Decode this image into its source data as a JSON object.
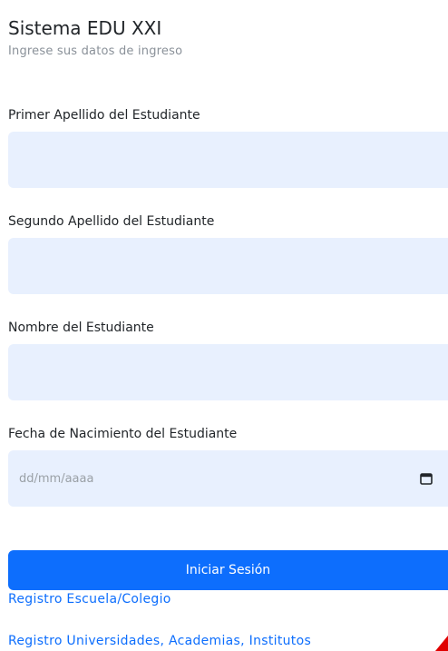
{
  "header": {
    "title": "Sistema EDU XXI",
    "subtitle": "Ingrese sus datos de ingreso"
  },
  "form": {
    "first_surname_label": "Primer Apellido del Estudiante",
    "first_surname_value": "",
    "second_surname_label": "Segundo Apellido del Estudiante",
    "second_surname_value": "",
    "name_label": "Nombre del Estudiante",
    "name_value": "",
    "birthdate_label": "Fecha de Nacimiento del Estudiante",
    "birthdate_placeholder": "dd/mm/aaaa",
    "birthdate_icon": "calendar-icon",
    "submit_label": "Iniciar Sesión"
  },
  "links": {
    "school_registration": "Registro Escuela/Colegio",
    "university_registration": "Registro Universidades, Academias, Institutos"
  },
  "colors": {
    "input_background": "#e8f0fe",
    "primary": "#0d6efd",
    "muted_text": "#8a9199",
    "marker": "#e00000"
  }
}
